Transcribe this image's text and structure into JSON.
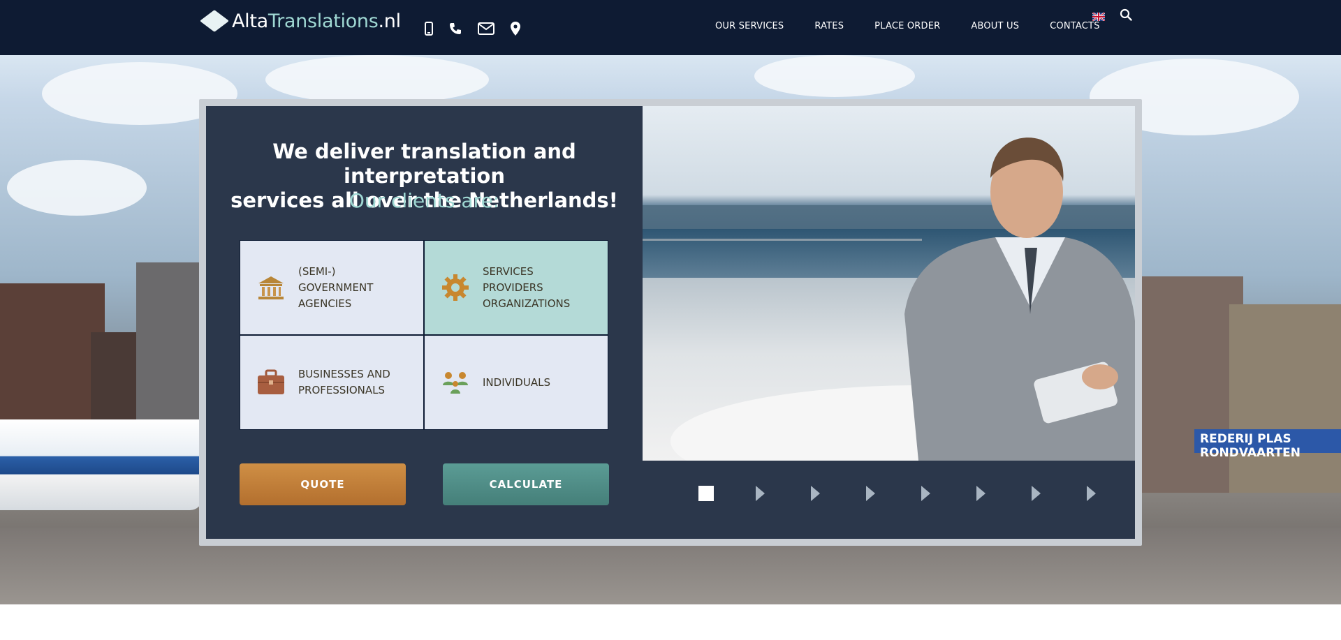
{
  "brand": {
    "name_part1": "Alta",
    "name_part2": "Translations",
    "name_part3": ".nl"
  },
  "header": {
    "contact_icons": [
      "mobile-icon",
      "phone-icon",
      "email-icon",
      "location-icon"
    ],
    "nav": [
      "OUR SERVICES",
      "RATES",
      "PLACE ORDER",
      "ABOUT US",
      "CONTACTS"
    ],
    "language_flag": "uk-flag-icon",
    "search_icon": "search-icon"
  },
  "hero": {
    "sign_text": "REDERIJ PLAS RONDVAARTEN",
    "headline_line1": "We deliver translation and interpretation",
    "headline_line2": "services all over the Netherlands!",
    "subline": "Our clients are:",
    "clients": [
      {
        "label": "(SEMI-)\nGOVERNMENT\nAGENCIES",
        "icon": "government-building-icon"
      },
      {
        "label": "SERVICES\nPROVIDERS\nORGANIZATIONS",
        "icon": "gear-icon"
      },
      {
        "label": "BUSINESSES AND\nPROFESSIONALS",
        "icon": "briefcase-icon"
      },
      {
        "label": "INDIVIDUALS",
        "icon": "people-icon"
      }
    ],
    "quote_button": "QUOTE",
    "calculate_button": "CALCULATE",
    "slider": {
      "total_slides": 8,
      "active_slide": 1
    }
  },
  "colors": {
    "header_bg": "#0e1b33",
    "accent_teal": "#9fd8d3",
    "quote_orange": "#c07d3a",
    "calculate_teal": "#4f8e88"
  }
}
